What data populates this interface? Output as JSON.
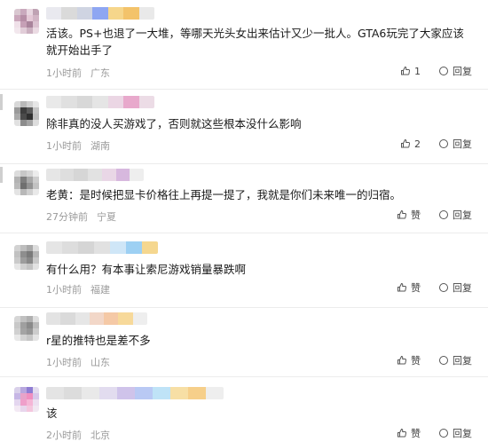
{
  "icons": {
    "like": "thumbs-up-icon",
    "reply": "reply-bubble-icon"
  },
  "comments": [
    {
      "text": "活该。PS+也退了一大堆，等哪天光头女出来估计又少一批人。GTA6玩完了大家应该就开始出手了",
      "time": "1小时前",
      "location": "广东",
      "likes": "1",
      "reply": "回复"
    },
    {
      "text": "除非真的没人买游戏了，否则就这些根本没什么影响",
      "time": "1小时前",
      "location": "湖南",
      "likes": "2",
      "reply": "回复"
    },
    {
      "text": "老黄：是时候把显卡价格往上再提一提了，我就是你们未来唯一的归宿。",
      "time": "27分钟前",
      "location": "宁夏",
      "likes": "赞",
      "reply": "回复"
    },
    {
      "text": "有什么用？有本事让索尼游戏销量暴跌啊",
      "time": "1小时前",
      "location": "福建",
      "likes": "赞",
      "reply": "回复"
    },
    {
      "text": "r星的推特也是差不多",
      "time": "1小时前",
      "location": "山东",
      "likes": "赞",
      "reply": "回复"
    },
    {
      "text": "该",
      "time": "2小时前",
      "location": "北京",
      "likes": "赞",
      "reply": "回复"
    }
  ]
}
